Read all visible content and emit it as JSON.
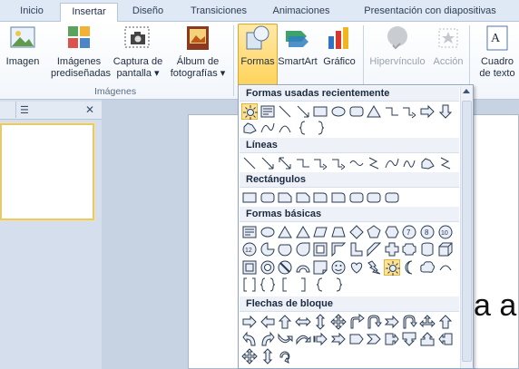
{
  "tabs": [
    "Inicio",
    "Insertar",
    "Diseño",
    "Transiciones",
    "Animaciones",
    "Presentación con diapositivas"
  ],
  "active_tab": "Insertar",
  "ribbon": {
    "imagen": "Imagen",
    "predis_1": "Imágenes",
    "predis_2": "prediseñadas",
    "captura_1": "Captura de",
    "captura_2": "pantalla ▾",
    "album_1": "Álbum de",
    "album_2": "fotografías ▾",
    "formas": "Formas",
    "smartart": "SmartArt",
    "grafico": "Gráfico",
    "hipervinculo": "Hipervínculo",
    "accion": "Acción",
    "cuadro_1": "Cuadro",
    "cuadro_2": "de texto",
    "group_imagenes": "Imágenes"
  },
  "pane": {
    "close": "✕"
  },
  "dropdown": {
    "sections": [
      "Formas usadas recientemente",
      "Líneas",
      "Rectángulos",
      "Formas básicas",
      "Flechas de bloque"
    ]
  },
  "slide": {
    "text": "a a"
  },
  "colors": {
    "accent": "#ffd35c",
    "ribbon_bg": "#dfe8f5"
  }
}
